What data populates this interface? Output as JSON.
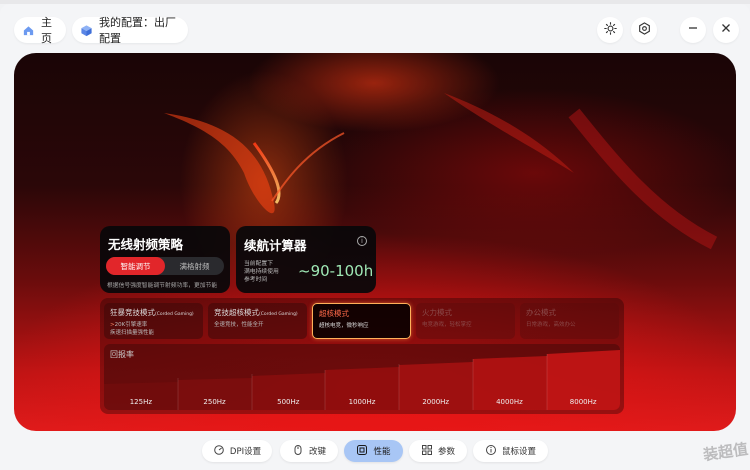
{
  "header": {
    "home_label": "主页",
    "profile_label": "我的配置：出厂配置",
    "icons": [
      "home-icon",
      "cube-icon",
      "brightness-icon",
      "settings-hex-icon",
      "minimize-icon",
      "close-icon"
    ]
  },
  "rf_card": {
    "title": "无线射频策略",
    "options": [
      "智能调节",
      "满格射频"
    ],
    "selected": "智能调节",
    "note": "根据信号强度智能调节射频功率，更加节能"
  },
  "battery_card": {
    "title": "续航计算器",
    "desc_lines": [
      "当前配置下",
      "满电持续使用",
      "参考时间"
    ],
    "value": "~90-100h"
  },
  "modes": [
    {
      "name": "狂暴竞技模式",
      "tag": "(Corded Gaming)",
      "line1": "20K引擎速率",
      "line2": "疾速扫描量强性能"
    },
    {
      "name": "竞技超核模式",
      "tag": "(Corded Gaming)",
      "line1": "全速竞技，性能全开",
      "line2": ""
    },
    {
      "name": "超核模式",
      "tag": "",
      "line1": "超核电竞，微秒响应",
      "line2": ""
    },
    {
      "name": "火力模式",
      "tag": "",
      "line1": "电竞游戏，轻松掌控",
      "line2": ""
    },
    {
      "name": "办公模式",
      "tag": "",
      "line1": "日常游戏，高效办公",
      "line2": ""
    }
  ],
  "polling": {
    "label": "回报率",
    "rates": [
      "125Hz",
      "250Hz",
      "500Hz",
      "1000Hz",
      "2000Hz",
      "4000Hz",
      "8000Hz"
    ]
  },
  "bottom_nav": [
    {
      "label": "DPI设置",
      "icon": "dpi-icon"
    },
    {
      "label": "改键",
      "icon": "mouse-icon"
    },
    {
      "label": "性能",
      "icon": "performance-icon"
    },
    {
      "label": "参数",
      "icon": "grid-icon"
    },
    {
      "label": "鼠标设置",
      "icon": "info-icon"
    }
  ],
  "active_nav": "性能",
  "watermark": "装超值",
  "colors": {
    "accent_red": "#e2262a",
    "battery_green": "#9fe8b5",
    "nav_active": "#a8c6f5",
    "selected_border": "#ffb05a"
  }
}
